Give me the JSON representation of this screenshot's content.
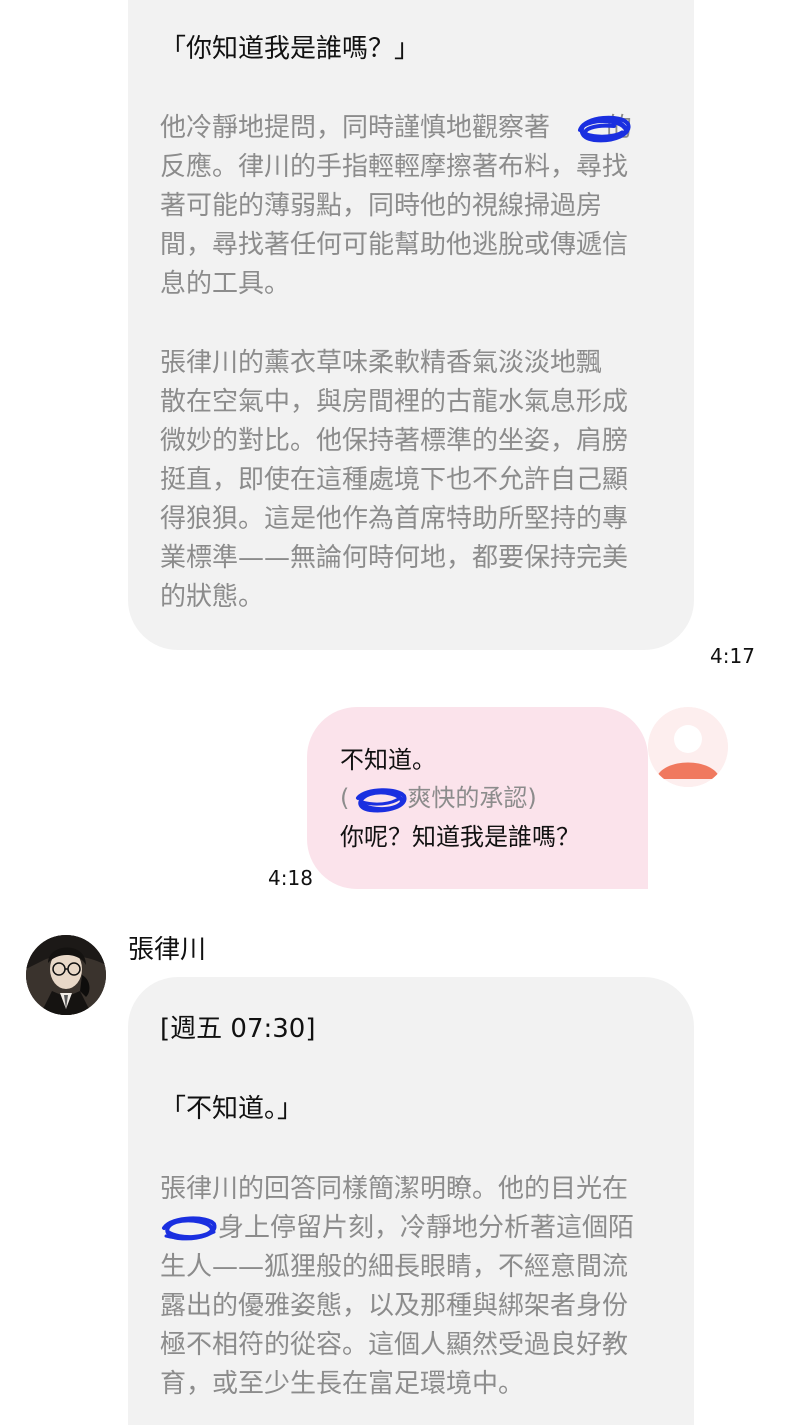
{
  "messages": [
    {
      "sender": "character",
      "paragraphs": [
        "「你知道我是誰嗎？」",
        "他冷靜地提問，同時謹慎地觀察著",
        "的",
        "反應。律川的手指輕輕摩擦著布料，尋找",
        "著可能的薄弱點，同時他的視線掃過房",
        "間，尋找著任何可能幫助他逃脫或傳遞信",
        "息的工具。",
        "張律川的薰衣草味柔軟精香氣淡淡地飄",
        "散在空氣中，與房間裡的古龍水氣息形成",
        "微妙的對比。他保持著標準的坐姿，肩膀",
        "挺直，即使在這種處境下也不允許自己顯",
        "得狼狽。這是他作為首席特助所堅持的專",
        "業標準——無論何時何地，都要保持完美",
        "的狀態。"
      ],
      "time": "4:17"
    },
    {
      "sender": "user",
      "lines": [
        "不知道。",
        "(",
        "爽快的承認)",
        "你呢？知道我是誰嗎？"
      ],
      "time": "4:18"
    },
    {
      "sender": "character",
      "name": "張律川",
      "lines": [
        "[週五 07:30]",
        "「不知道。」",
        "張律川的回答同樣簡潔明瞭。他的目光在",
        "身上停留片刻，冷靜地分析著這個陌",
        "生人——狐狸般的細長眼睛，不經意間流",
        "露出的優雅姿態，以及那種與綁架者身份",
        "極不相符的從容。這個人顯然受過良好教",
        "育，或至少生長在富足環境中。"
      ]
    }
  ],
  "colors": {
    "incoming_bubble": "#f2f2f2",
    "outgoing_bubble": "#fbe3eb",
    "narration_text": "#8c8c8c",
    "redaction_scribble": "#1a2fe0",
    "user_avatar_accent": "#f0795f"
  },
  "icons": {
    "user_avatar": "default-person-icon",
    "character_avatar": "character-portrait-icon",
    "redaction": "scribble-redaction-icon"
  }
}
